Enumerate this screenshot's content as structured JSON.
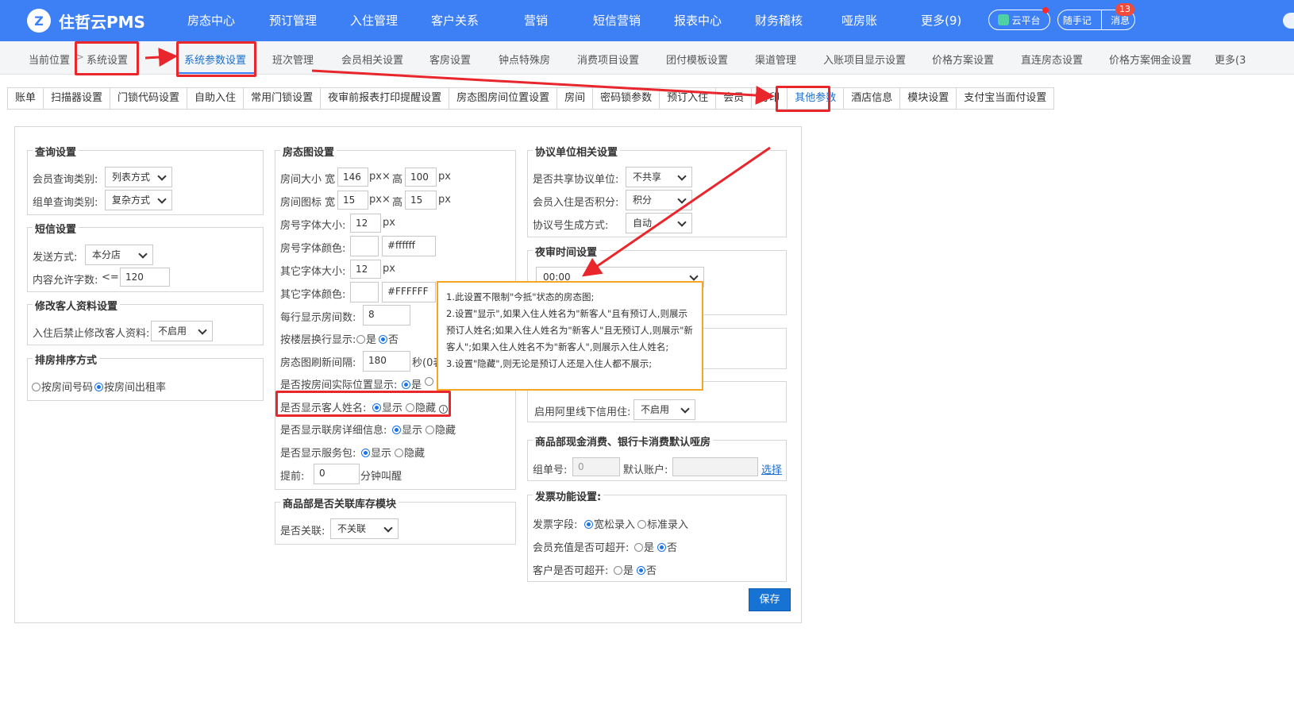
{
  "app": {
    "logo_mark": "Z",
    "title": "住哲云PMS"
  },
  "nav": [
    "房态中心",
    "预订管理",
    "入住管理",
    "客户关系",
    "营销",
    "短信营销",
    "报表中心",
    "财务稽核",
    "哑房账",
    "更多(9)"
  ],
  "nav_right": {
    "cloud": "云平台",
    "note": "随手记",
    "msg": "消息",
    "msg_count": "13"
  },
  "breadcrumb": {
    "prefix": "当前位置",
    "arrow": ">",
    "system": "系统设置",
    "current": "系统参数设置"
  },
  "subnav": [
    "班次管理",
    "会员相关设置",
    "客房设置",
    "钟点特殊房",
    "消费项目设置",
    "团付模板设置",
    "渠道管理",
    "入账项目显示设置",
    "价格方案设置",
    "直连房态设置",
    "价格方案佣金设置",
    "更多(3"
  ],
  "tabs": [
    "账单",
    "扫描器设置",
    "门锁代码设置",
    "自助入住",
    "常用门锁设置",
    "夜审前报表打印提醒设置",
    "房态图房间位置设置",
    "房间",
    "密码锁参数",
    "预订入住",
    "会员",
    "打印",
    "其他参数",
    "酒店信息",
    "模块设置",
    "支付宝当面付设置"
  ],
  "query": {
    "legend": "查询设置",
    "member_label": "会员查询类别:",
    "member_value": "列表方式",
    "group_label": "组单查询类别:",
    "group_value": "复杂方式"
  },
  "sms": {
    "legend": "短信设置",
    "send_label": "发送方式:",
    "send_value": "本分店",
    "chars_label": "内容允许字数:",
    "chars_op": "<=",
    "chars_value": "120"
  },
  "guest": {
    "legend": "修改客人资料设置",
    "forbid_label": "入住后禁止修改客人资料:",
    "forbid_value": "不启用"
  },
  "sort": {
    "legend": "排房排序方式",
    "opt1": "按房间号码",
    "opt2": "按房间出租率"
  },
  "roommap": {
    "legend": "房态图设置",
    "size_label": "房间大小 宽",
    "size_w": "146",
    "px": "px",
    "x": "×",
    "high": "高",
    "size_h": "100",
    "icon_label": "房间图标 宽",
    "icon_w": "15",
    "icon_h": "15",
    "font_label": "房号字体大小:",
    "font_value": "12",
    "color_label": "房号字体颜色:",
    "color_value": "#ffffff",
    "other_font_label": "其它字体大小:",
    "other_font_value": "12",
    "other_color_label": "其它字体颜色:",
    "other_color_value": "#FFFFFF",
    "perrow_label": "每行显示房间数:",
    "perrow_value": "8",
    "floor_label": "按楼层换行显示:",
    "yes": "是",
    "no": "否",
    "refresh_label": "房态图刷新间隔:",
    "refresh_value": "180",
    "refresh_unit": "秒(0表",
    "pos_label": "是否按房间实际位置显示:",
    "name_label": "是否显示客人姓名:",
    "show": "显示",
    "hide": "隐藏",
    "info": "i",
    "linked_label": "是否显示联房详细信息:",
    "service_label": "是否显示服务包:",
    "ahead_label": "提前:",
    "ahead_value": "0",
    "ahead_unit": "分钟叫醒"
  },
  "stock": {
    "legend": "商品部是否关联库存模块",
    "label": "是否关联:",
    "value": "不关联"
  },
  "agreement": {
    "legend": "协议单位相关设置",
    "share_label": "是否共享协议单位:",
    "share_value": "不共享",
    "points_label": "会员入住是否积分:",
    "points_value": "积分",
    "gen_label": "协议号生成方式:",
    "gen_value": "自动"
  },
  "night": {
    "legend": "夜审时间设置",
    "time": "00:00"
  },
  "ali": {
    "label": "启用阿里线下信用住:",
    "value": "不启用"
  },
  "shop": {
    "legend": "商品部现金消费、银行卡消费默认哑房",
    "group_label": "组单号:",
    "group_value": "0",
    "account_label": "默认账户:",
    "select": "选择"
  },
  "invoice": {
    "legend": "发票功能设置:",
    "field_label": "发票字段:",
    "loose": "宽松录入",
    "standard": "标准录入",
    "member_label": "会员充值是否可超开:",
    "customer_label": "客户是否可超开:",
    "yes": "是",
    "no": "否"
  },
  "tooltip": [
    "1.此设置不限制\"今抵\"状态的房态图;",
    "2.设置\"显示\",如果入住人姓名为\"新客人\"且有预订人,则展示预订人姓名;如果入住人姓名为\"新客人\"且无预订人,则展示\"新客人\";如果入住人姓名不为\"新客人\",则展示入住人姓名;",
    "3.设置\"隐藏\",则无论是预订人还是入住人都不展示;"
  ],
  "save": "保存",
  "colors": {
    "nav_bg": "#3d7ff5",
    "highlight": "#e8262b",
    "tooltip_border": "#f5a623",
    "save_btn": "#1673d4"
  }
}
